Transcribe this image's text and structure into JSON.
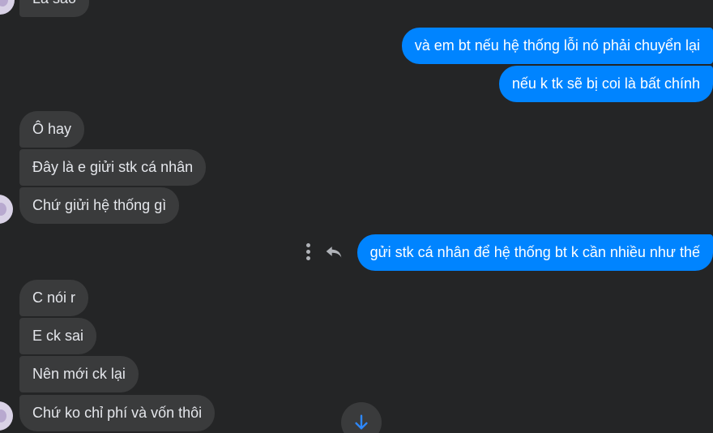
{
  "messages": {
    "m0": "Là sao",
    "m1": "và em bt nếu hệ thống lỗi nó phải chuyển lại",
    "m2": "nếu k tk sẽ bị coi là bất chính",
    "m3": "Ô hay",
    "m4": "Đây là e giửi stk cá nhân",
    "m5": "Chứ giửi hệ thống gì",
    "m6": "gửi stk cá nhân để hệ thống bt k cần nhiều như thế",
    "m7": "C nói r",
    "m8": "E ck sai",
    "m9": "Nên mới ck lại",
    "m10": "Chứ ko chỉ phí và vốn thôi"
  },
  "colors": {
    "background": "#242526",
    "incoming_bubble": "#3a3b3c",
    "outgoing_bubble": "#0084ff",
    "scroll_arrow": "#2d88ff"
  },
  "icons": {
    "options": "more-vertical-icon",
    "reply": "reply-icon",
    "scroll": "arrow-down-icon"
  }
}
